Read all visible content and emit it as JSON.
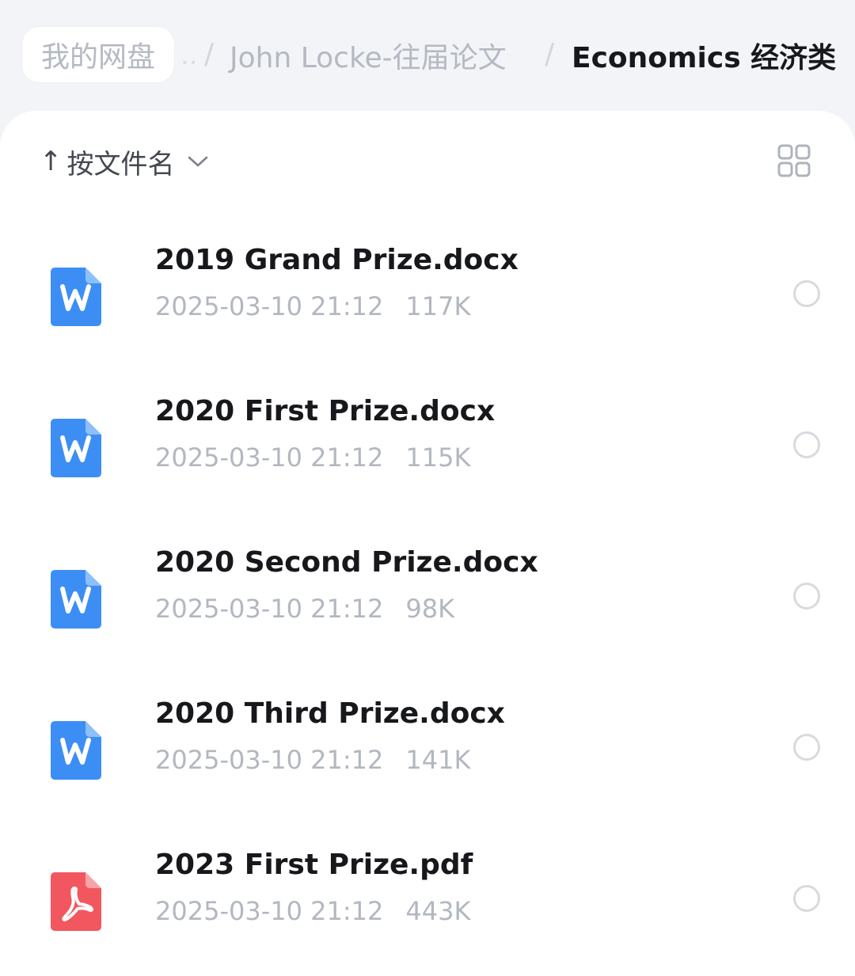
{
  "breadcrumb": {
    "root": "我的网盘",
    "ellipsis": "..",
    "separator": "/",
    "middle": "John Locke-往届论文",
    "current": "Economics 经济类"
  },
  "sort": {
    "arrow": "↑",
    "label": "按文件名"
  },
  "files": [
    {
      "name": "2019 Grand Prize.docx",
      "date": "2025-03-10 21:12",
      "size": "117K",
      "type": "word"
    },
    {
      "name": "2020 First Prize.docx",
      "date": "2025-03-10 21:12",
      "size": "115K",
      "type": "word"
    },
    {
      "name": "2020 Second Prize.docx",
      "date": "2025-03-10 21:12",
      "size": "98K",
      "type": "word"
    },
    {
      "name": "2020 Third Prize.docx",
      "date": "2025-03-10 21:12",
      "size": "141K",
      "type": "word"
    },
    {
      "name": "2023 First Prize.pdf",
      "date": "2025-03-10 21:12",
      "size": "443K",
      "type": "pdf"
    }
  ],
  "icons": {
    "word": "word-file-icon",
    "pdf": "pdf-file-icon",
    "grid": "grid-view-icon",
    "chevron": "chevron-down-icon"
  },
  "colors": {
    "word_blue": "#3d8ef4",
    "pdf_red": "#f2575f",
    "text_primary": "#17181c",
    "text_secondary": "#b2b7c0"
  }
}
